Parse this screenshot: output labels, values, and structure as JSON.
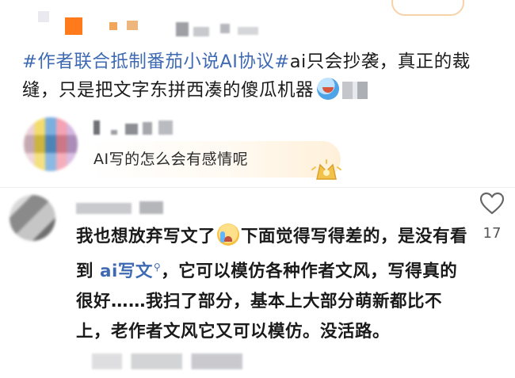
{
  "post": {
    "hashtag": "#作者联合抵制番茄小说AI协议#",
    "text": "ai只会抄袭，真正的裁缝，只是把文字东拼西凑的傻瓜机器",
    "emoji_icon": "grinning-face-icon"
  },
  "reply1": {
    "text": "AI写的怎么会有感情呢",
    "badge_icon": "gold-badge-icon"
  },
  "comment2": {
    "text_part1": "我也想放弃写文了",
    "emoji_icon": "crying-face-icon",
    "text_part2": "下面觉得写得差的，是没有看到",
    "link_text": "ai写文",
    "text_part3": "，它可以模仿各种作者文风，写得真的很好……我扫了部分，基本上大部分萌新都比不上，老作者文风它又可以模仿。没活路。",
    "like_icon": "heart-outline-icon",
    "like_count": "17"
  },
  "colors": {
    "link": "#3e6ab3",
    "text": "#1a1a1a"
  }
}
